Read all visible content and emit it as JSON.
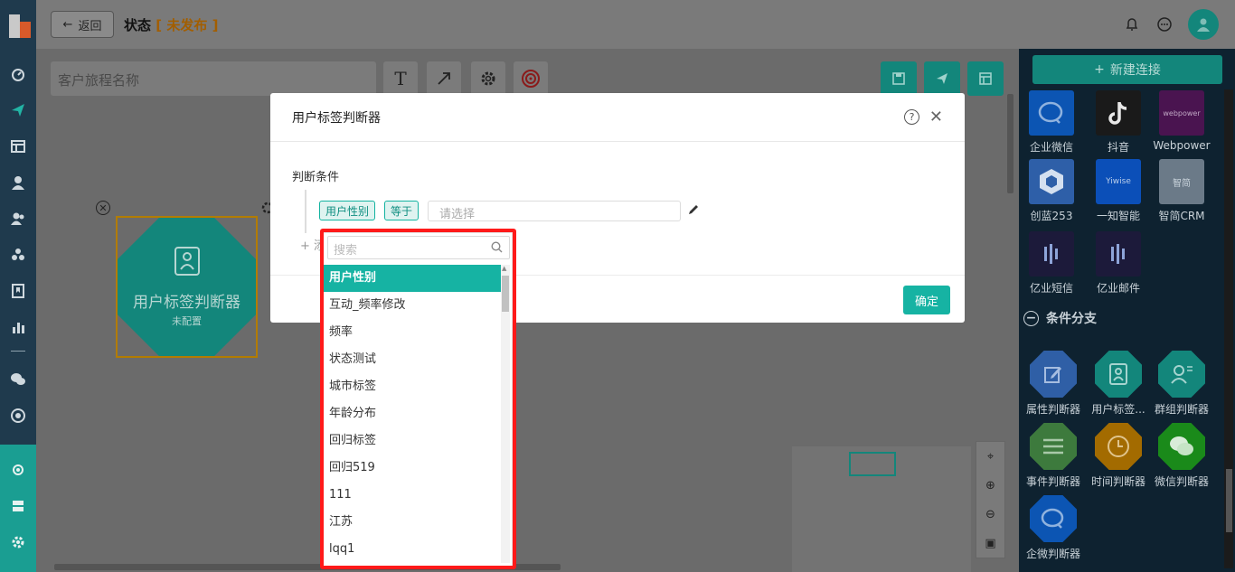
{
  "header": {
    "back_label": "返回",
    "title": "状态",
    "status_open": "[",
    "status": "未发布",
    "status_close": "]"
  },
  "nav_icons": [
    "dashboard-icon",
    "send-icon",
    "layout-icon",
    "user-icon",
    "users-icon",
    "cluster-icon",
    "bookmark-icon",
    "chart-icon",
    "wechat-icon",
    "target-icon",
    "flow-icon",
    "server-icon",
    "settings-icon"
  ],
  "canvas": {
    "name_placeholder": "客户旅程名称",
    "node_label": "用户标签判断器",
    "node_sub": "未配置"
  },
  "right_panel": {
    "new_connection": "新建连接",
    "apps": [
      {
        "label": "企业微信",
        "color": "#0c55b3"
      },
      {
        "label": "抖音",
        "color": "#1a1a1a"
      },
      {
        "label": "Webpower",
        "color": "#4a1450"
      },
      {
        "label": "创蓝253",
        "color": "#2e5fa8"
      },
      {
        "label": "一知智能",
        "color": "#0b4fb8"
      },
      {
        "label": "智简CRM",
        "color": "#6b7a88"
      },
      {
        "label": "亿业短信",
        "color": "#1c1a3a"
      },
      {
        "label": "亿业邮件",
        "color": "#1c1a3a"
      }
    ],
    "app_tile_texts": {
      "webpower": "webpower",
      "yiwise": "Yiwise",
      "crm": "智简"
    },
    "section_title": "条件分支",
    "conditions": [
      {
        "label": "属性判断器",
        "color": "#2f5fa6"
      },
      {
        "label": "用户标签...",
        "color": "#13867b"
      },
      {
        "label": "群组判断器",
        "color": "#13867b"
      },
      {
        "label": "事件判断器",
        "color": "#3d7a3d"
      },
      {
        "label": "时间判断器",
        "color": "#a36b00"
      },
      {
        "label": "微信判断器",
        "color": "#1a8a1a"
      },
      {
        "label": "企微判断器",
        "color": "#0c55b3"
      }
    ]
  },
  "modal": {
    "title": "用户标签判断器",
    "condition_label": "判断条件",
    "tag_field": "用户性别",
    "tag_operator": "等于",
    "value_placeholder": "请选择",
    "add_text": "+ 添",
    "confirm": "确定"
  },
  "dropdown": {
    "search_placeholder": "搜索",
    "options": [
      "用户性别",
      "互动_频率修改",
      "频率",
      "状态测试",
      "城市标签",
      "年龄分布",
      "回归标签",
      "回归519",
      "111",
      "江苏",
      "lqq1"
    ],
    "selected_index": 0
  }
}
